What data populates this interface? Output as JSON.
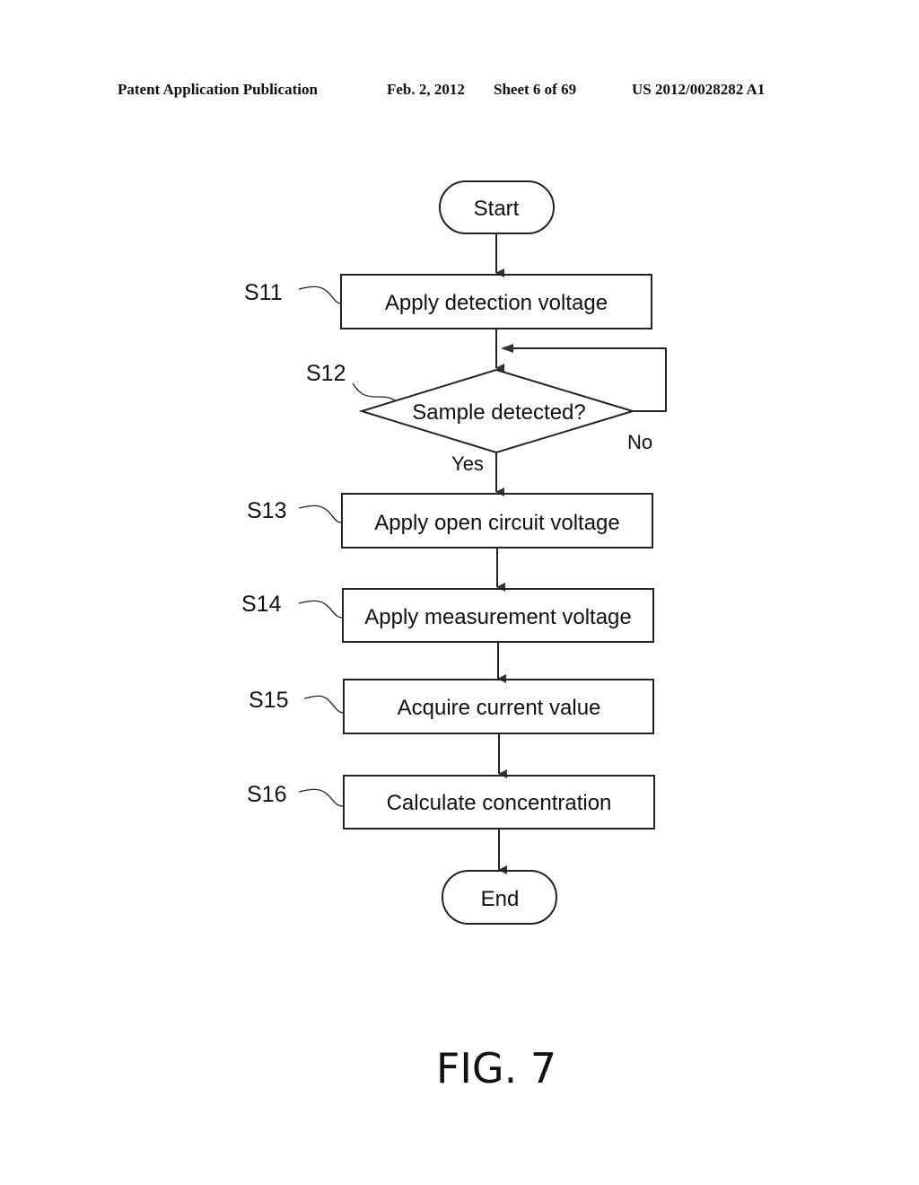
{
  "header": {
    "publication": "Patent Application Publication",
    "date": "Feb. 2, 2012",
    "sheet": "Sheet 6 of 69",
    "number": "US 2012/0028282 A1"
  },
  "flowchart": {
    "start": "Start",
    "end": "End",
    "steps": [
      {
        "id": "S11",
        "label": "Apply detection voltage",
        "type": "process"
      },
      {
        "id": "S12",
        "label": "Sample detected?",
        "type": "decision",
        "yes": "Yes",
        "no": "No"
      },
      {
        "id": "S13",
        "label": "Apply open circuit voltage",
        "type": "process"
      },
      {
        "id": "S14",
        "label": "Apply measurement voltage",
        "type": "process"
      },
      {
        "id": "S15",
        "label": "Acquire current value",
        "type": "process"
      },
      {
        "id": "S16",
        "label": "Calculate concentration",
        "type": "process"
      }
    ]
  },
  "figure_label": "FIG. 7"
}
